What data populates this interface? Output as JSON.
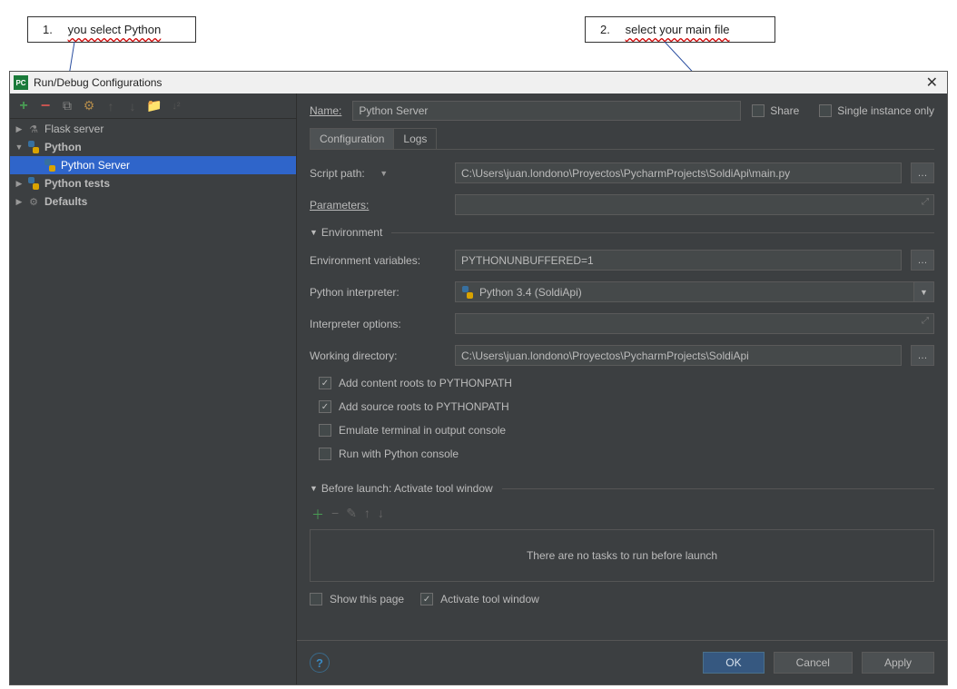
{
  "callouts": {
    "c1_num": "1.",
    "c1_txt": "you select Python",
    "c2_num": "2.",
    "c2_txt": "select your main file"
  },
  "titlebar": {
    "title": "Run/Debug Configurations",
    "icon_text": "PC"
  },
  "tree": {
    "items": [
      {
        "label": "Flask server",
        "level": 1,
        "expandable": true,
        "expanded": false
      },
      {
        "label": "Python",
        "level": 1,
        "expandable": true,
        "expanded": true,
        "bold": true
      },
      {
        "label": "Python Server",
        "level": 2,
        "selected": true
      },
      {
        "label": "Python tests",
        "level": 1,
        "expandable": true,
        "expanded": false,
        "bold": true
      },
      {
        "label": "Defaults",
        "level": 1,
        "expandable": true,
        "expanded": false,
        "bold": true
      }
    ]
  },
  "form": {
    "name_label": "Name:",
    "name_value": "Python Server",
    "share_label": "Share",
    "single_instance_label": "Single instance only",
    "tabs": {
      "config": "Configuration",
      "logs": "Logs"
    },
    "script_path_label": "Script path:",
    "script_path_value": "C:\\Users\\juan.londono\\Proyectos\\PycharmProjects\\SoldiApi\\main.py",
    "parameters_label": "Parameters:",
    "parameters_value": "",
    "env_section": "Environment",
    "env_vars_label": "Environment variables:",
    "env_vars_value": "PYTHONUNBUFFERED=1",
    "interpreter_label": "Python interpreter:",
    "interpreter_value": "Python 3.4 (SoldiApi)",
    "interpreter_options_label": "Interpreter options:",
    "interpreter_options_value": "",
    "working_dir_label": "Working directory:",
    "working_dir_value": "C:\\Users\\juan.londono\\Proyectos\\PycharmProjects\\SoldiApi",
    "cb_content_roots": "Add content roots to PYTHONPATH",
    "cb_source_roots": "Add source roots to PYTHONPATH",
    "cb_emulate": "Emulate terminal in output console",
    "cb_run_console": "Run with Python console",
    "before_launch_section": "Before launch: Activate tool window",
    "before_launch_empty": "There are no tasks to run before launch",
    "cb_show_page": "Show this page",
    "cb_activate_tool": "Activate tool window"
  },
  "footer": {
    "ok": "OK",
    "cancel": "Cancel",
    "apply": "Apply"
  }
}
